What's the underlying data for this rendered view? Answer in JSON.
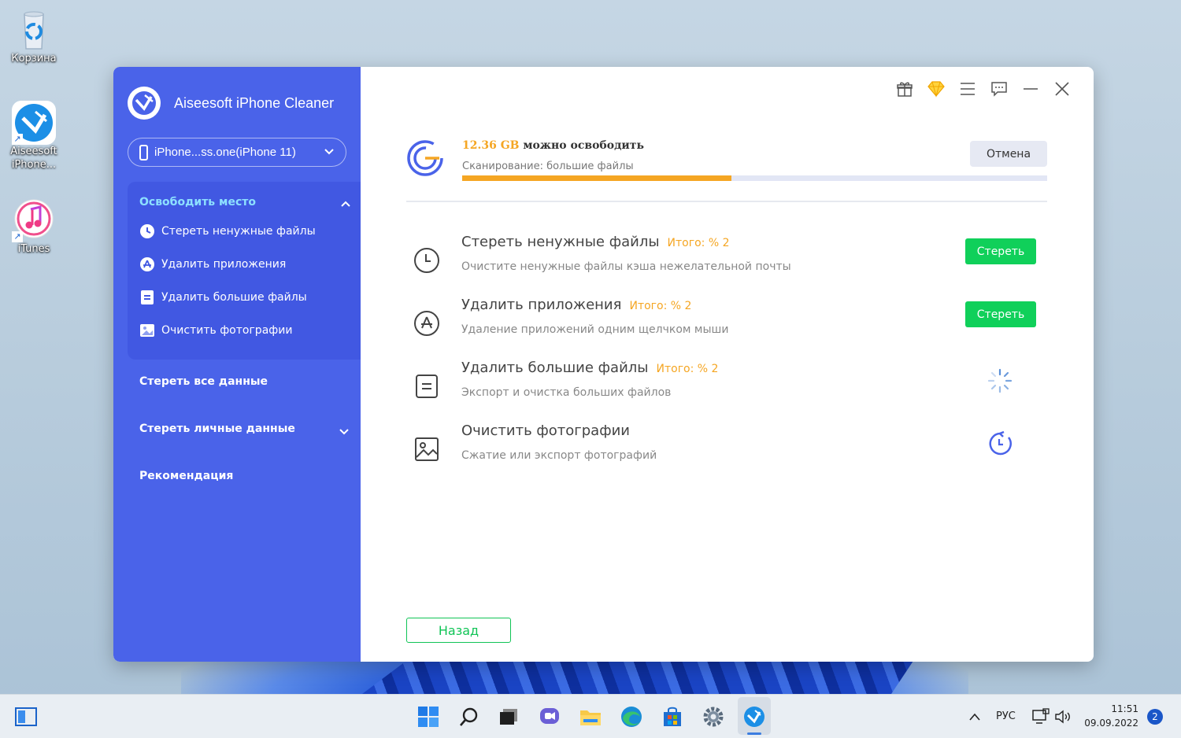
{
  "desktop": {
    "icons": [
      {
        "label": "Корзина"
      },
      {
        "label": "Aiseesoft iPhone..."
      },
      {
        "label": "iTunes"
      }
    ]
  },
  "app": {
    "title": "Aiseesoft iPhone Cleaner",
    "device": "iPhone...ss.one(iPhone 11)",
    "sidebar": {
      "group_title": "Освободить место",
      "sub_items": [
        {
          "label": "Стереть ненужные файлы",
          "icon": "clock-icon"
        },
        {
          "label": "Удалить приложения",
          "icon": "app-store-icon"
        },
        {
          "label": "Удалить большие файлы",
          "icon": "document-icon"
        },
        {
          "label": "Очистить фотографии",
          "icon": "photo-icon"
        }
      ],
      "nav_items": [
        {
          "label": "Стереть все данные"
        },
        {
          "label": "Стереть личные данные"
        },
        {
          "label": "Рекомендация"
        }
      ]
    },
    "window_controls": [
      "gift-icon",
      "diamond-icon",
      "menu-icon",
      "feedback-icon",
      "minimize-icon",
      "close-icon"
    ],
    "scan": {
      "amount": "12.36 GB",
      "freed_suffix": " можно освободить",
      "status": "Сканирование: большие файлы",
      "progress": 0.46,
      "cancel_label": "Отмена"
    },
    "features": [
      {
        "title": "Стереть ненужные файлы",
        "total": "Итого: % 2",
        "desc": "Очистите ненужные файлы кэша нежелательной почты",
        "action": "Стереть",
        "state": "done"
      },
      {
        "title": "Удалить приложения",
        "total": "Итого: % 2",
        "desc": "Удаление приложений одним щелчком мыши",
        "action": "Стереть",
        "state": "done"
      },
      {
        "title": "Удалить большие файлы",
        "total": "Итого: % 2",
        "desc": "Экспорт и очистка больших файлов",
        "state": "loading"
      },
      {
        "title": "Очистить фотографии",
        "total": "",
        "desc": "Сжатие или экспорт фотографий",
        "state": "pending"
      }
    ],
    "back_label": "Назад"
  },
  "taskbar": {
    "apps": [
      "start-icon",
      "search-icon",
      "task-view-icon",
      "chat-icon",
      "file-explorer-icon",
      "edge-icon",
      "store-icon",
      "settings-icon",
      "aiseesoft-icon"
    ],
    "language": "РУС",
    "time": "11:51",
    "date": "09.09.2022",
    "notifications": "2"
  },
  "colors": {
    "sidebar": "#4a63e9",
    "accent_orange": "#f5a623",
    "green": "#10d05a",
    "group_title": "#8de0ff"
  }
}
